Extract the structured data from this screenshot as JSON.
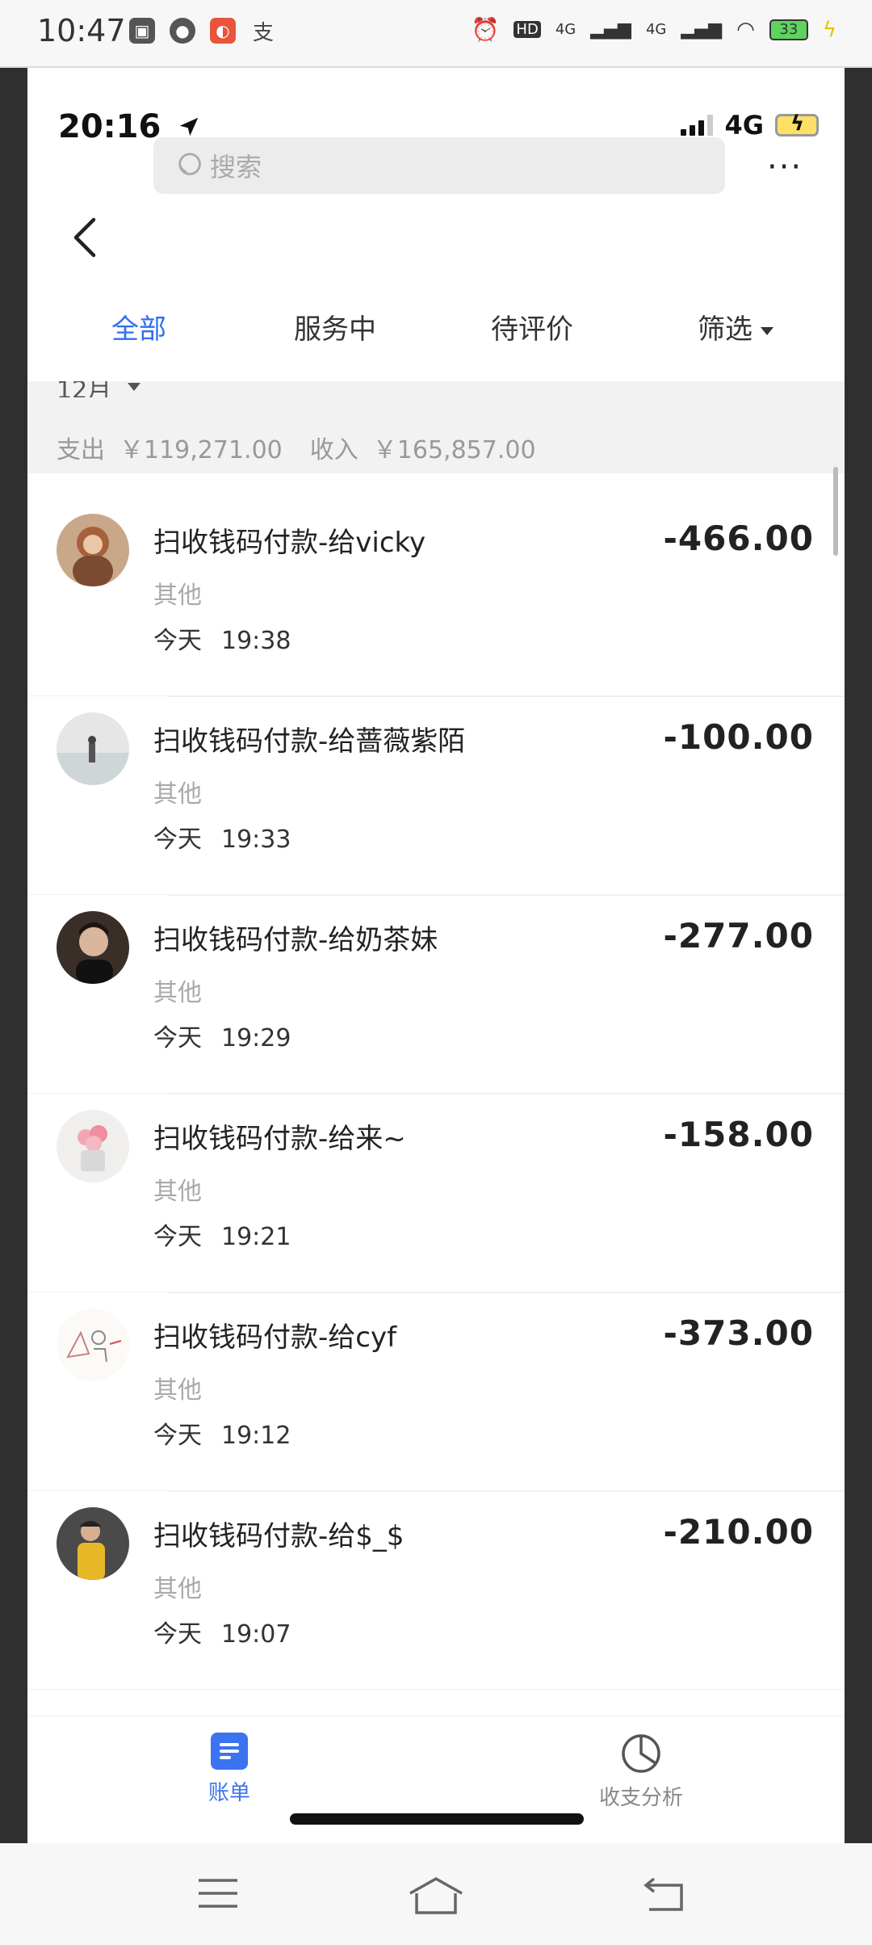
{
  "outer_status": {
    "time": "10:47",
    "battery": "33",
    "network1": "4G",
    "network2": "4G",
    "hd_label": "HD"
  },
  "inner_status": {
    "time": "20:16",
    "network": "4G"
  },
  "search": {
    "placeholder": "搜索"
  },
  "more_label": "···",
  "tabs": [
    {
      "label": "全部",
      "active": true
    },
    {
      "label": "服务中",
      "active": false
    },
    {
      "label": "待评价",
      "active": false
    },
    {
      "label": "筛选",
      "active": false
    }
  ],
  "summary": {
    "month": "12月",
    "expense_label": "支出",
    "expense": "￥119,271.00",
    "income_label": "收入",
    "income": "￥165,857.00"
  },
  "transactions": [
    {
      "title": "扫收钱码付款-给vicky",
      "category": "其他",
      "day": "今天",
      "time": "19:38",
      "amount": "-466.00"
    },
    {
      "title": "扫收钱码付款-给蔷薇紫陌",
      "category": "其他",
      "day": "今天",
      "time": "19:33",
      "amount": "-100.00"
    },
    {
      "title": "扫收钱码付款-给奶茶妹",
      "category": "其他",
      "day": "今天",
      "time": "19:29",
      "amount": "-277.00"
    },
    {
      "title": "扫收钱码付款-给来~",
      "category": "其他",
      "day": "今天",
      "time": "19:21",
      "amount": "-158.00"
    },
    {
      "title": "扫收钱码付款-给cyf",
      "category": "其他",
      "day": "今天",
      "time": "19:12",
      "amount": "-373.00"
    },
    {
      "title": "扫收钱码付款-给$_$",
      "category": "其他",
      "day": "今天",
      "time": "19:07",
      "amount": "-210.00"
    }
  ],
  "bottom_nav": {
    "bill": "账单",
    "analysis": "收支分析"
  },
  "colors": {
    "accent": "#2f6ff0",
    "text": "#222222",
    "muted": "#aaaaaa"
  }
}
